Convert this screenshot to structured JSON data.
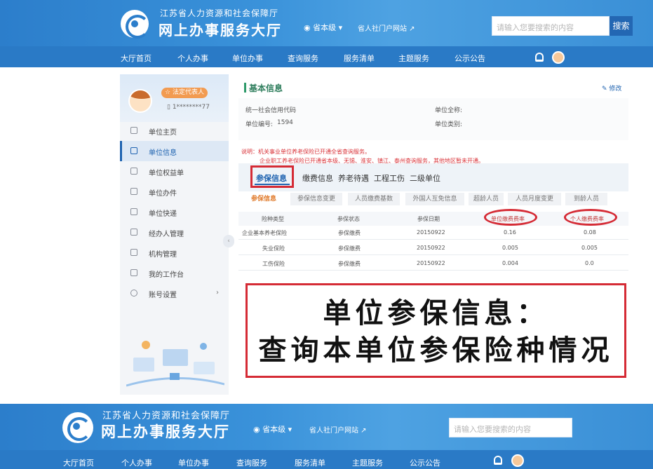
{
  "header": {
    "org_name": "江苏省人力资源和社会保障厅",
    "hall_name": "网上办事服务大厅",
    "level": "省本级",
    "portal_link": "省人社门户网站",
    "search_placeholder": "请输入您要搜索的内容",
    "search_button": "搜索",
    "nav": [
      "大厅首页",
      "个人办事",
      "单位办事",
      "查询服务",
      "服务清单",
      "主题服务",
      "公示公告"
    ]
  },
  "profile": {
    "role_badge": "法定代表人",
    "phone": "1********77"
  },
  "sidebar": {
    "items": [
      {
        "label": "单位主页",
        "active": false
      },
      {
        "label": "单位信息",
        "active": true
      },
      {
        "label": "单位权益单",
        "active": false
      },
      {
        "label": "单位办件",
        "active": false
      },
      {
        "label": "单位快递",
        "active": false
      },
      {
        "label": "经办人管理",
        "active": false
      },
      {
        "label": "机构管理",
        "active": false
      },
      {
        "label": "我的工作台",
        "active": false
      },
      {
        "label": "账号设置",
        "active": false
      }
    ]
  },
  "basic_info": {
    "title": "基本信息",
    "edit": "修改",
    "credit_code_label": "统一社会信用代码",
    "full_name_label": "单位全称:",
    "unit_no_label": "单位编号:",
    "unit_no_value": "1594",
    "unit_type_label": "单位类别:"
  },
  "notes": {
    "line1": "说明：机关事业单位养老保险已开通全省查询服务。",
    "line2": "企业职工养老保险已开通省本级、无锡、淮安、镇江、泰州查询服务，其他地区暂未开通。"
  },
  "tabs": [
    "参保信息",
    "缴费信息",
    "养老待遇",
    "工程工伤",
    "二级单位"
  ],
  "subtabs": [
    "参保信息",
    "参保信息变更",
    "人员缴费基数",
    "外国人互免信息",
    "超龄人员",
    "人员月度变更",
    "到龄人员"
  ],
  "table": {
    "headers": [
      "险种类型",
      "参保状态",
      "参保日期",
      "单位缴费费率",
      "个人缴费费率"
    ],
    "rows": [
      [
        "企业基本养老保险",
        "参保缴费",
        "20150922",
        "0.16",
        "0.08"
      ],
      [
        "失业保险",
        "参保缴费",
        "20150922",
        "0.005",
        "0.005"
      ],
      [
        "工伤保险",
        "参保缴费",
        "20150922",
        "0.004",
        "0.0"
      ]
    ]
  },
  "caption": {
    "line1": "单位参保信息：",
    "line2": "查询本单位参保险种情况"
  }
}
